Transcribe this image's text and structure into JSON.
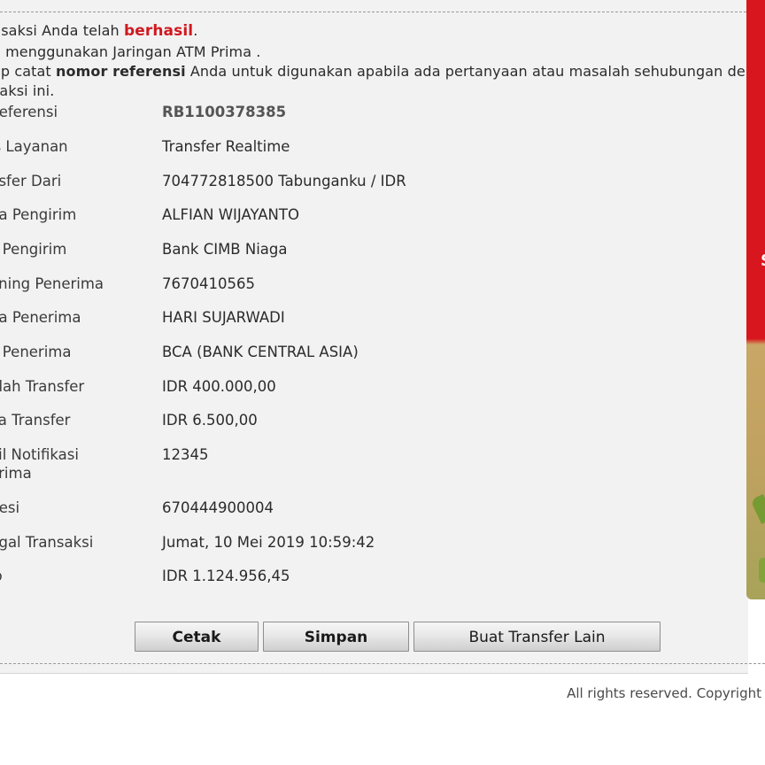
{
  "message": {
    "line1_prefix": "nsaksi Anda telah ",
    "line1_status": "berhasil",
    "line1_suffix": ".",
    "line2": "a menggunakan Jaringan ATM Prima .",
    "line3_prefix": "ap catat ",
    "line3_bold": "nomor referensi",
    "line3_suffix": " Anda untuk digunakan apabila ada pertanyaan atau masalah sehubungan denga",
    "line4": "saksi ini."
  },
  "details": [
    {
      "label": "Referensi",
      "value": "RB1100378385"
    },
    {
      "label": "is Layanan",
      "value": "Transfer Realtime"
    },
    {
      "label": "nsfer Dari",
      "value": "704772818500 Tabunganku / IDR"
    },
    {
      "label": "na Pengirim",
      "value": "ALFIAN WIJAYANTO"
    },
    {
      "label": "k Pengirim",
      "value": "Bank CIMB Niaga"
    },
    {
      "label": "ening Penerima",
      "value": "7670410565"
    },
    {
      "label": "na Penerima",
      "value": "HARI SUJARWADI"
    },
    {
      "label": "k Penerima",
      "value": "BCA (BANK CENTRAL ASIA)"
    },
    {
      "label": "nlah Transfer",
      "value": "IDR 400.000,00"
    },
    {
      "label": "ya Transfer",
      "value": "IDR 6.500,00"
    },
    {
      "label": "ail Notifikasi",
      "label2": "erima",
      "value": "12345"
    },
    {
      "label": "Resi",
      "value": "670444900004"
    },
    {
      "label": "ggal Transaksi",
      "value": "Jumat, 10 Mei 2019 10:59:42"
    },
    {
      "label": "lo",
      "value": "IDR 1.124.956,45"
    }
  ],
  "buttons": {
    "print": "Cetak",
    "save": "Simpan",
    "new_transfer": "Buat Transfer Lain"
  },
  "banner": {
    "glyph": "S"
  },
  "footer": {
    "text": "All rights reserved. Copyright"
  },
  "colors": {
    "accent": "#d0181f",
    "panel": "#f2f2f2",
    "banner_red": "#d8161d"
  }
}
